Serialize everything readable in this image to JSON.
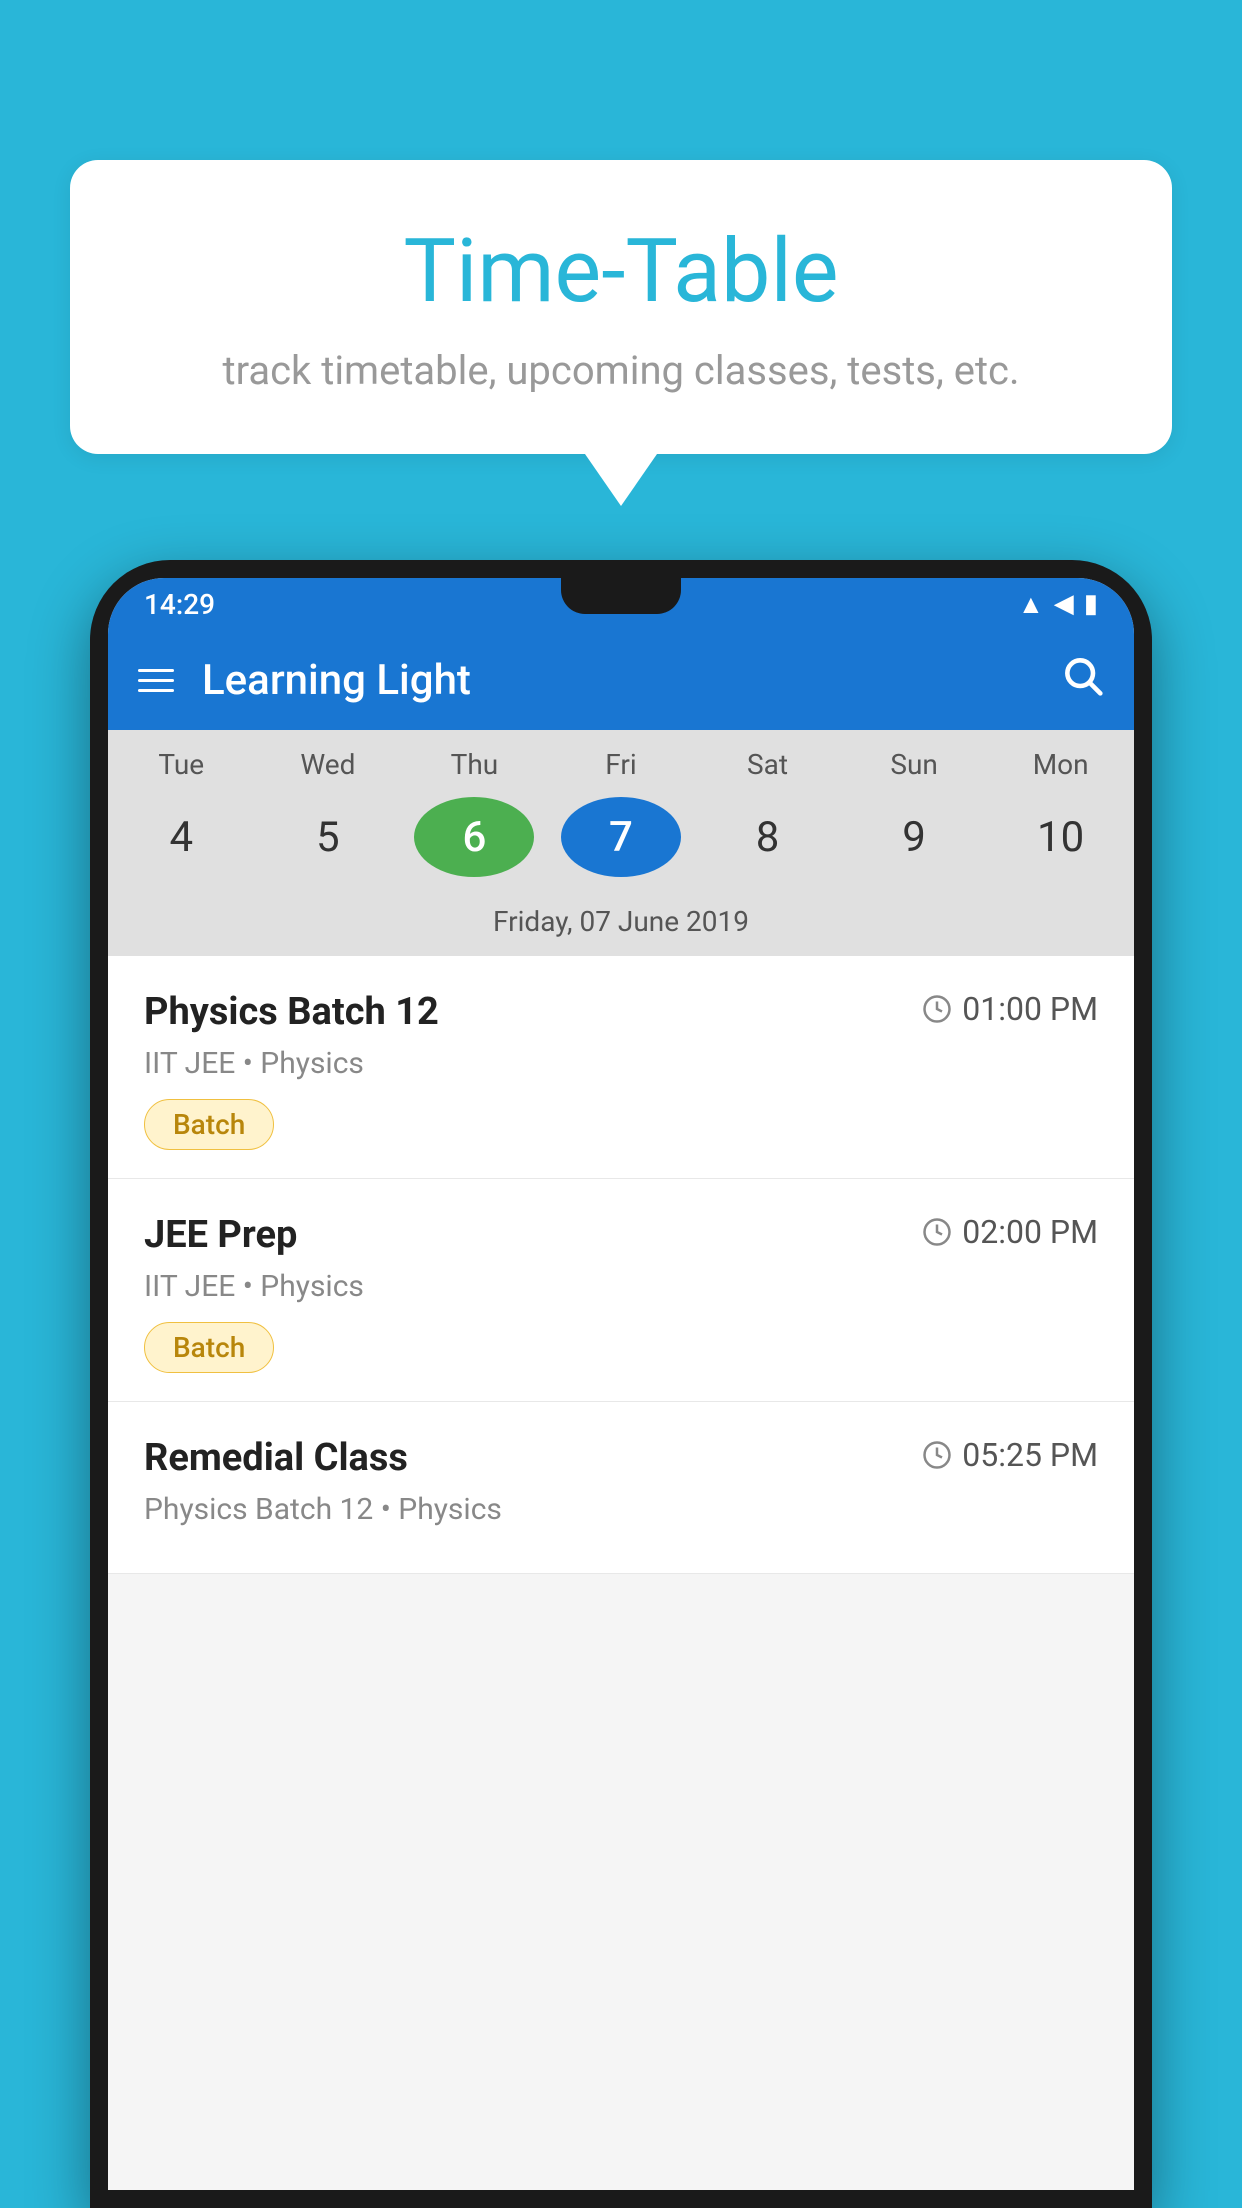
{
  "background_color": "#29B6D8",
  "speech_bubble": {
    "title": "Time-Table",
    "subtitle": "track timetable, upcoming classes, tests, etc."
  },
  "phone": {
    "status_bar": {
      "time": "14:29"
    },
    "app_header": {
      "title": "Learning Light"
    },
    "calendar": {
      "days": [
        "Tue",
        "Wed",
        "Thu",
        "Fri",
        "Sat",
        "Sun",
        "Mon"
      ],
      "dates": [
        "4",
        "5",
        "6",
        "7",
        "8",
        "9",
        "10"
      ],
      "today_index": 2,
      "selected_index": 3,
      "selected_label": "Friday, 07 June 2019"
    },
    "schedule_items": [
      {
        "title": "Physics Batch 12",
        "time": "01:00 PM",
        "subtitle": "IIT JEE • Physics",
        "badge": "Batch"
      },
      {
        "title": "JEE Prep",
        "time": "02:00 PM",
        "subtitle": "IIT JEE • Physics",
        "badge": "Batch"
      },
      {
        "title": "Remedial Class",
        "time": "05:25 PM",
        "subtitle": "Physics Batch 12 • Physics",
        "badge": null
      }
    ]
  }
}
